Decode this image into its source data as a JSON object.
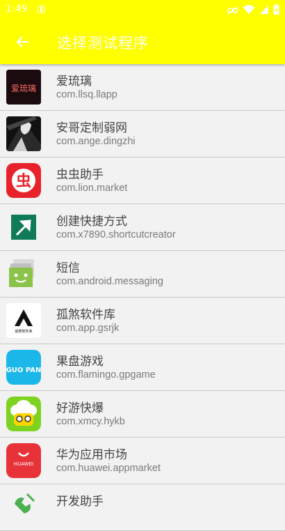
{
  "status_bar": {
    "time": "1:49"
  },
  "toolbar": {
    "title": "选择测试程序"
  },
  "apps": [
    {
      "name": "爱琉璃",
      "package": "com.llsq.llapp",
      "icon": "ailiuli-icon",
      "icon_text": "爱琉璃"
    },
    {
      "name": "安哥定制弱网",
      "package": "com.ange.dingzhi",
      "icon": "ange-icon"
    },
    {
      "name": "虫虫助手",
      "package": "com.lion.market",
      "icon": "chongchong-icon",
      "icon_text": "虫"
    },
    {
      "name": "创建快捷方式",
      "package": "com.x7890.shortcutcreator",
      "icon": "shortcut-arrow-icon"
    },
    {
      "name": "短信",
      "package": "com.android.messaging",
      "icon": "messaging-icon"
    },
    {
      "name": "孤煞软件库",
      "package": "com.app.gsrjk",
      "icon": "gusha-icon",
      "icon_text": "孤煞软件库"
    },
    {
      "name": "果盘游戏",
      "package": "com.flamingo.gpgame",
      "icon": "guopan-icon",
      "icon_text": "GUO PAN"
    },
    {
      "name": "好游快爆",
      "package": "com.xmcy.hykb",
      "icon": "haoyou-icon"
    },
    {
      "name": "华为应用市场",
      "package": "com.huawei.appmarket",
      "icon": "huawei-appgallery-icon",
      "icon_text": "HUAWEI"
    },
    {
      "name": "开发助手",
      "package": "",
      "icon": "dev-helper-icon"
    }
  ],
  "colors": {
    "toolbar": "#ffff00",
    "background": "#f2f2f2"
  }
}
